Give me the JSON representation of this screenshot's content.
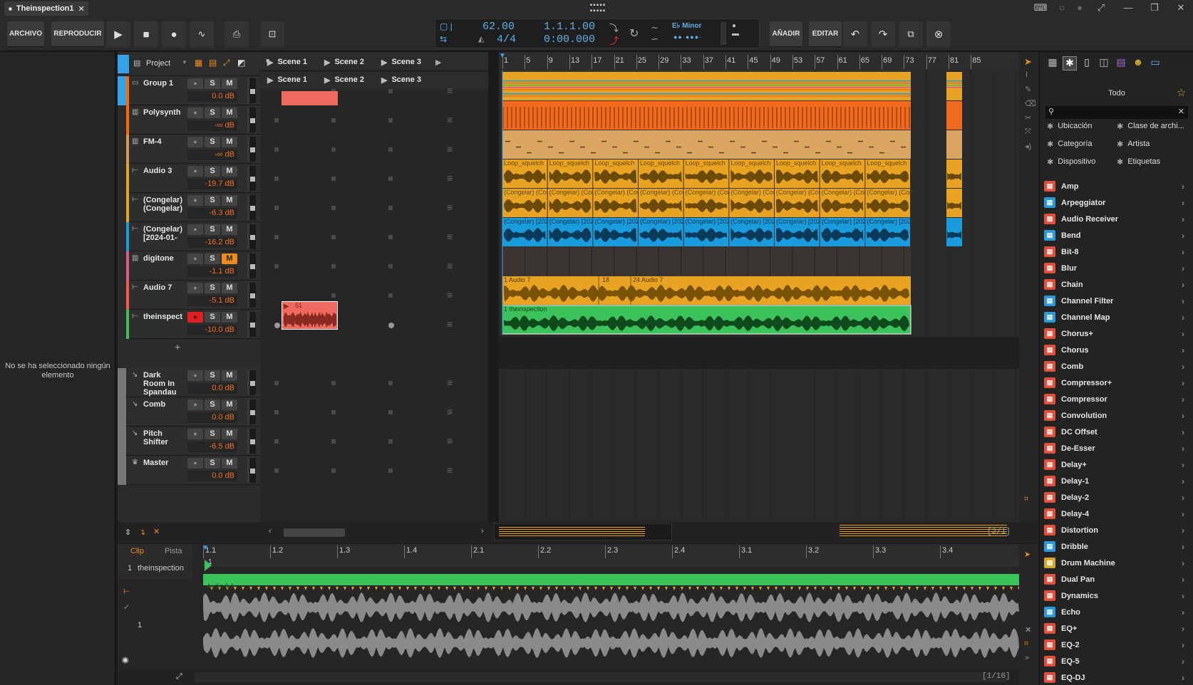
{
  "window": {
    "tab_title": "Theinspection1",
    "close_glyph": "✕"
  },
  "toolbar": {
    "file": "ARCHIVO",
    "play_menu": "REPRODUCIR",
    "add": "AÑADIR",
    "edit": "EDITAR"
  },
  "transport": {
    "tempo": "62.00",
    "signature": "4/4",
    "position_bars": "1.1.1.00",
    "position_time": "0:00.000",
    "key": "E♭ Minor"
  },
  "inspector": {
    "empty_message": "No se ha seleccionado ningún elemento"
  },
  "launcher_header": {
    "project": "Project",
    "scenes": [
      "Scene 1",
      "Scene 2",
      "Scene 3"
    ],
    "scene_rows": [
      "Scene 1",
      "Scene 2",
      "Scene 3"
    ]
  },
  "tracks": [
    {
      "name": "Group 1",
      "volume": "0.0 dB",
      "color": "#ff6a00"
    },
    {
      "name": "Polysynth",
      "volume": "-∞ dB",
      "color": "#ff6a00"
    },
    {
      "name": "FM-4",
      "volume": "-∞ dB",
      "color": "#d79b43"
    },
    {
      "name": "Audio 3",
      "volume": "-19.7 dB",
      "color": "#e8a322"
    },
    {
      "name": "(Congelar) (Congelar)",
      "volume": "-6.3 dB",
      "color": "#e8a322"
    },
    {
      "name": "(Congelar) [2024-01-",
      "volume": "-16.2 dB",
      "color": "#1a9bdc"
    },
    {
      "name": "digitone",
      "volume": "-1.1 dB",
      "color": "#e05a8e"
    },
    {
      "name": "Audio 7",
      "volume": "-5.1 dB",
      "color": "#f05a4a"
    },
    {
      "name": "theinspect",
      "volume": "-10.0 dB",
      "color": "#3cc25a"
    }
  ],
  "effect_tracks": [
    {
      "name": "Dark Room In Spandau",
      "volume": "0.0 dB"
    },
    {
      "name": "Comb",
      "volume": "0.0 dB"
    },
    {
      "name": "Pitch Shifter",
      "volume": "-6.5 dB"
    },
    {
      "name": "Master",
      "volume": "0.0 dB"
    }
  ],
  "button_labels": {
    "solo": "S",
    "mute": "M"
  },
  "launcher_clip_label": "51",
  "ruler": {
    "bars": [
      "1",
      "5",
      "9",
      "13",
      "17",
      "21",
      "25",
      "29",
      "33",
      "37",
      "41",
      "45",
      "49",
      "53",
      "57",
      "61",
      "65",
      "69",
      "73",
      "77",
      "81",
      "85"
    ]
  },
  "arranger_clips": {
    "audio3": "Loop_squelch",
    "congelar": "(Congelar) (Con",
    "congelar_blue": "(Congelar) [202",
    "audio7_a": "1 Audio 7",
    "audio7_b": "18",
    "audio7_c": "24 Audio 7",
    "theinspection": "1 theinspection"
  },
  "zoom_readouts": {
    "arranger": "[2/1]",
    "editor": "[1/16]"
  },
  "editor": {
    "tab_clip": "Clip",
    "tab_track": "Pista",
    "track_index": "1",
    "track_name": "theinspection",
    "ruler": [
      "1.1",
      "1.2",
      "1.3",
      "1.4",
      "2.1",
      "2.2",
      "2.3",
      "2.4",
      "3.1",
      "3.2",
      "3.3",
      "3.4"
    ],
    "clip_name": "Audio 8-1",
    "lane_index": "1",
    "marker": "1"
  },
  "browser": {
    "title": "Todo",
    "filters": [
      "Ubicación",
      "Clase de archi...",
      "Categoría",
      "Artista",
      "Dispositivo",
      "Etiquetas"
    ],
    "items": [
      {
        "name": "Amp",
        "color": "#e0503a"
      },
      {
        "name": "Arpeggiator",
        "color": "#2d9ad8"
      },
      {
        "name": "Audio Receiver",
        "color": "#e0503a"
      },
      {
        "name": "Bend",
        "color": "#2d9ad8"
      },
      {
        "name": "Bit-8",
        "color": "#e0503a"
      },
      {
        "name": "Blur",
        "color": "#e0503a"
      },
      {
        "name": "Chain",
        "color": "#e0503a"
      },
      {
        "name": "Channel Filter",
        "color": "#2d9ad8"
      },
      {
        "name": "Channel Map",
        "color": "#2d9ad8"
      },
      {
        "name": "Chorus+",
        "color": "#e0503a"
      },
      {
        "name": "Chorus",
        "color": "#e0503a"
      },
      {
        "name": "Comb",
        "color": "#e0503a"
      },
      {
        "name": "Compressor+",
        "color": "#e0503a"
      },
      {
        "name": "Compressor",
        "color": "#e0503a"
      },
      {
        "name": "Convolution",
        "color": "#e0503a"
      },
      {
        "name": "DC Offset",
        "color": "#e0503a"
      },
      {
        "name": "De-Esser",
        "color": "#e0503a"
      },
      {
        "name": "Delay+",
        "color": "#e0503a"
      },
      {
        "name": "Delay-1",
        "color": "#e0503a"
      },
      {
        "name": "Delay-2",
        "color": "#e0503a"
      },
      {
        "name": "Delay-4",
        "color": "#e0503a"
      },
      {
        "name": "Distortion",
        "color": "#e0503a"
      },
      {
        "name": "Dribble",
        "color": "#2d9ad8"
      },
      {
        "name": "Drum Machine",
        "color": "#d4a82a"
      },
      {
        "name": "Dual Pan",
        "color": "#e0503a"
      },
      {
        "name": "Dynamics",
        "color": "#e0503a"
      },
      {
        "name": "Echo",
        "color": "#2d9ad8"
      },
      {
        "name": "EQ+",
        "color": "#e0503a"
      },
      {
        "name": "EQ-2",
        "color": "#e0503a"
      },
      {
        "name": "EQ-5",
        "color": "#e0503a"
      },
      {
        "name": "EQ-DJ",
        "color": "#e0503a"
      }
    ]
  }
}
